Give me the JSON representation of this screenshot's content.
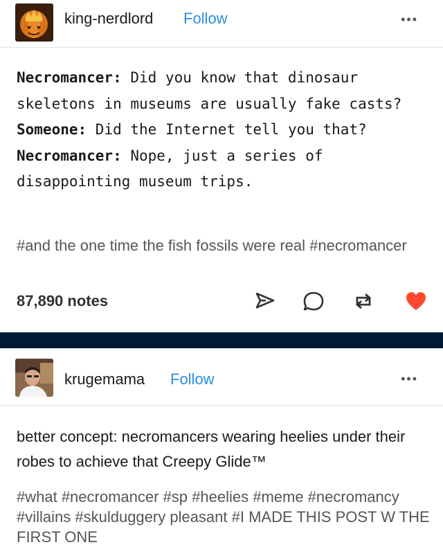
{
  "post1": {
    "username": "king-nerdlord",
    "follow_label": "Follow",
    "more_label": "•••",
    "dialog": [
      {
        "speaker": "Necromancer:",
        "text": " Did you know that dinosaur skeletons in museums are usually fake casts?"
      },
      {
        "speaker": "Someone:",
        "text": " Did the Internet tell you that?"
      },
      {
        "speaker": "Necromancer:",
        "text": " Nope, just a series of disappointing museum trips."
      }
    ],
    "tags": "#and the one time the fish fossils were real #necromancer",
    "notes": "87,890 notes",
    "icons": [
      "share-icon",
      "reply-icon",
      "reblog-icon",
      "like-icon"
    ],
    "like_color": "#ff4930"
  },
  "post2": {
    "username": "krugemama",
    "follow_label": "Follow",
    "more_label": "•••",
    "text": "better concept: necromancers wearing heelies under their robes to achieve that Creepy Glide™",
    "tags": "#what #necromancer #sp #heelies #meme #necromancy #villains #skulduggery pleasant #I MADE THIS POST W THE FIRST ONE"
  },
  "colors": {
    "follow": "#2a8de2",
    "divider": "#001935"
  }
}
